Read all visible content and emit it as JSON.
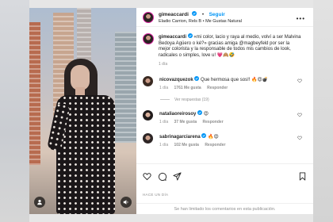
{
  "post": {
    "username": "gimeaccardi",
    "verified": true,
    "follow_label": "Seguir",
    "audio": "Eladio Carrion, Rels B • Me Gustas Natural",
    "more_label": "•••"
  },
  "caption": {
    "username": "gimeaccardi",
    "text": "«mi color, lacio y raya al medio, volví a ser Malvina Bedoya Agüero o ké?» gracias amiga @magbeyfeld por ser la mejor colorista y la responsable de todos mis cambios de look, radicales o simples, love u! 💗🙈🤣",
    "time": "1 día"
  },
  "comments": [
    {
      "username": "nicovazquezok",
      "text": "Que hermosa que sos!! 🔥😍💣",
      "time": "1 día",
      "likes": "1761 Me gusta",
      "reply": "Responder",
      "view_replies": "Ver respuestas (19)"
    },
    {
      "username": "nataliaoreirosoy",
      "text": "😍",
      "time": "1 día",
      "likes": "37 Me gusta",
      "reply": "Responder"
    },
    {
      "username": "sabrinagarciarena",
      "text": "🔥😍",
      "time": "1 día",
      "likes": "102 Me gusta",
      "reply": "Responder"
    }
  ],
  "footer": {
    "date": "HACE UN DÍA",
    "comments_disabled": "Se han limitado los comentarios en esta publicación."
  },
  "colors": {
    "accent": "#0095f6",
    "text": "#262626",
    "muted": "#8e8e8e",
    "like": "#ed4956"
  },
  "icons": [
    "user-icon",
    "volume-icon",
    "heart-icon",
    "comment-icon",
    "share-icon",
    "bookmark-icon",
    "verified-icon"
  ]
}
